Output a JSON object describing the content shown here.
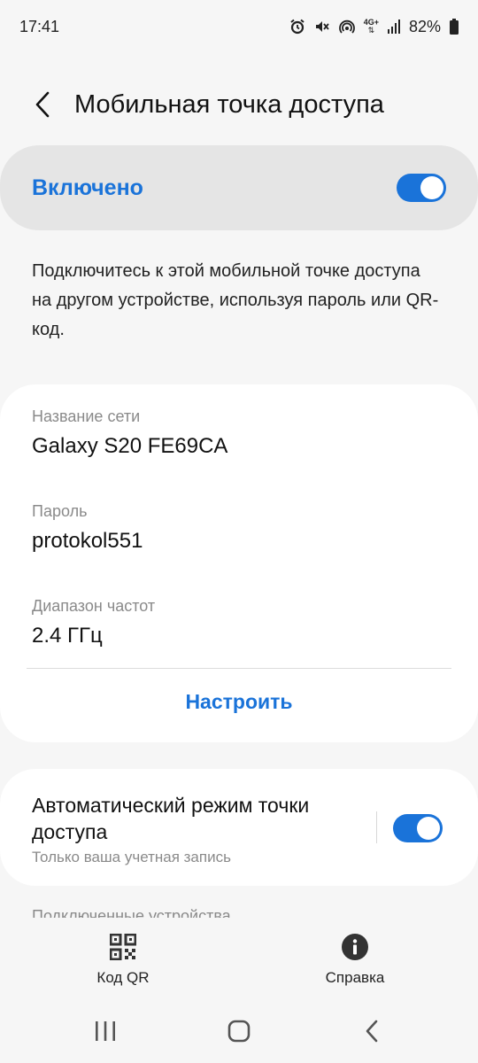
{
  "status_bar": {
    "time": "17:41",
    "battery_percent": "82%",
    "network_label": "4G+",
    "icons": [
      "alarm-icon",
      "mute-icon",
      "hotspot-icon",
      "network-4g-icon",
      "signal-icon",
      "battery-icon"
    ]
  },
  "header": {
    "title": "Мобильная точка доступа"
  },
  "master_switch": {
    "label": "Включено",
    "on": true
  },
  "description": "Подключитесь к этой мобильной точке доступа на другом устройстве, используя пароль или QR-код.",
  "network": {
    "name_label": "Название сети",
    "name_value": "Galaxy S20 FE69CA",
    "password_label": "Пароль",
    "password_value": "protokol551",
    "band_label": "Диапазон частот",
    "band_value": "2.4 ГГц",
    "configure_label": "Настроить"
  },
  "auto_hotspot": {
    "title": "Автоматический режим точки доступа",
    "subtitle": "Только ваша учетная запись",
    "on": true
  },
  "connected_devices_label": "Подключенные устройства",
  "bottom_actions": {
    "qr_label": "Код QR",
    "help_label": "Справка"
  },
  "colors": {
    "accent": "#1a73d9",
    "background": "#f6f6f6",
    "card": "#ffffff",
    "master_bg": "#e5e5e5"
  }
}
